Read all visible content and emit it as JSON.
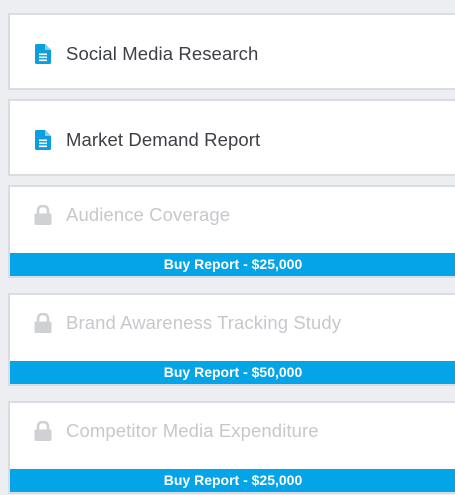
{
  "reports": [
    {
      "title": "Social Media Research",
      "icon": "document-icon",
      "locked": false
    },
    {
      "title": "Market Demand Report",
      "icon": "document-icon",
      "locked": false
    },
    {
      "title": "Audience Coverage",
      "icon": "lock-icon",
      "locked": true,
      "buy_label": "Buy Report - $25,000"
    },
    {
      "title": "Brand Awareness Tracking Study",
      "icon": "lock-icon",
      "locked": true,
      "buy_label": "Buy Report - $50,000"
    },
    {
      "title": "Competitor Media Expenditure",
      "icon": "lock-icon",
      "locked": true,
      "buy_label": "Buy Report - $25,000"
    }
  ],
  "colors": {
    "accent": "#04a4e9",
    "doc_icon": "#0b9fdf",
    "lock_icon": "#cfd1d4",
    "locked_text": "#c6c8cc",
    "text": "#3c3f44",
    "border": "#d9dde2"
  }
}
